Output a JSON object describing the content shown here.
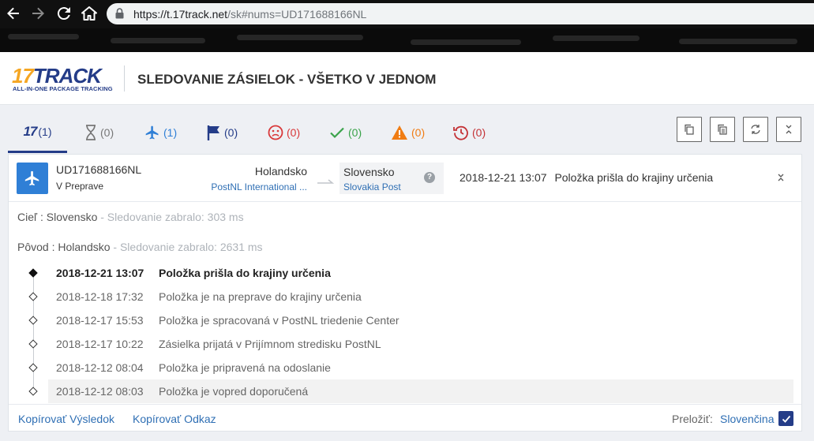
{
  "browser": {
    "url_host": "https://t.17track.net",
    "url_path": "/sk#nums=UD171688166NL"
  },
  "header": {
    "logo_number": "17",
    "logo_word": "TRACK",
    "logo_tagline": "ALL-IN-ONE PACKAGE TRACKING",
    "title": "SLEDOVANIE ZÁSIELOK - VŠETKO V JEDNOM"
  },
  "tabs": [
    {
      "icon": "17track-logo-icon",
      "logo": "17",
      "count": "(1)",
      "color": "#243c88"
    },
    {
      "icon": "hourglass-icon",
      "count": "(0)",
      "color": "#777777"
    },
    {
      "icon": "airplane-icon",
      "count": "(1)",
      "color": "#2f7fd6"
    },
    {
      "icon": "flag-icon",
      "count": "(0)",
      "color": "#243c88"
    },
    {
      "icon": "sad-face-icon",
      "count": "(0)",
      "color": "#d9383a"
    },
    {
      "icon": "checkmark-icon",
      "count": "(0)",
      "color": "#3aa34a"
    },
    {
      "icon": "warning-icon",
      "count": "(0)",
      "color": "#f07c13"
    },
    {
      "icon": "history-icon",
      "count": "(0)",
      "color": "#c43236"
    }
  ],
  "toolbar": {
    "icons": [
      "copy-icon",
      "copy-list-icon",
      "refresh-icon",
      "collapse-all-icon"
    ]
  },
  "shipment": {
    "tracking_number": "UD171688166NL",
    "status": "V Preprave",
    "origin_country": "Holandsko",
    "origin_carrier": "PostNL International ...",
    "dest_country": "Slovensko",
    "dest_carrier": "Slovakia Post",
    "latest_date": "2018-12-21 13:07",
    "latest_event": "Položka prišla do krajiny určenia"
  },
  "info": {
    "dest_label": "Cieľ : Slovensko",
    "dest_time": " - Sledovanie zabralo: 303 ms",
    "origin_label": "Pôvod : Holandsko",
    "origin_time": " - Sledovanie zabralo: 2631 ms"
  },
  "events": [
    {
      "date": "2018-12-21 13:07",
      "desc": "Položka prišla do krajiny určenia"
    },
    {
      "date": "2018-12-18 17:32",
      "desc": "Položka je na preprave do krajiny určenia"
    },
    {
      "date": "2018-12-17 15:53",
      "desc": "Položka je spracovaná v PostNL triedenie Center"
    },
    {
      "date": "2018-12-17 10:22",
      "desc": "Zásielka prijatá v Prijímnom stredisku PostNL"
    },
    {
      "date": "2018-12-12 08:04",
      "desc": "Položka je pripravená na odoslanie"
    },
    {
      "date": "2018-12-12 08:03",
      "desc": "Položka je vopred doporučená"
    }
  ],
  "footer": {
    "copy_result": "Kopírovať Výsledok",
    "copy_link": "Kopírovať Odkaz",
    "translate_label": "Preložiť:",
    "language": "Slovenčina"
  }
}
